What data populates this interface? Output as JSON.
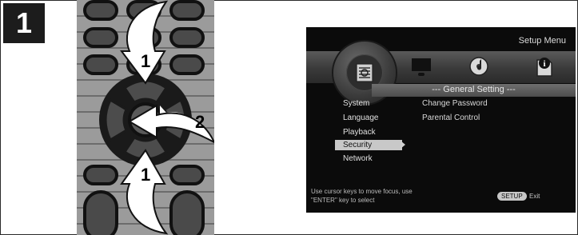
{
  "step": {
    "number": "1"
  },
  "remote": {
    "arrow_up_label": "1",
    "arrow_down_label": "1",
    "arrow_right_label": "2"
  },
  "screen": {
    "menu_title": "Setup Menu",
    "section_title": "--- General Setting ---",
    "menu_items": [
      "System",
      "Language",
      "Playback",
      "Security",
      "Network"
    ],
    "selected_item": "Security",
    "submenu_items": [
      "Change Password",
      "Parental Control"
    ],
    "hint_line1": "Use cursor keys to move focus, use",
    "hint_line2": "\"ENTER\" key to select",
    "setup_button": "SETUP",
    "exit_label": "Exit",
    "icons": [
      "settings-icon",
      "display-icon",
      "audio-disc-icon",
      "info-icon"
    ]
  },
  "colors": {
    "badge": "#1c1c1c",
    "remote_body": "#9b9b9b",
    "screen_bg": "#0b0b0b",
    "highlight": "#c8c8c8"
  }
}
